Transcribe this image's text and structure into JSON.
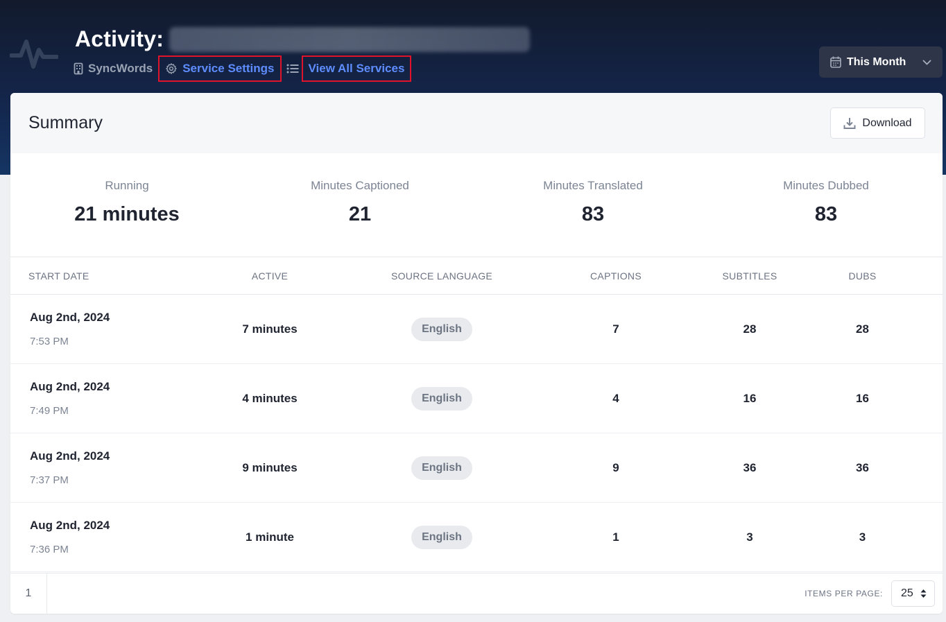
{
  "header": {
    "title": "Activity:",
    "org_name": "SyncWords",
    "service_settings_label": "Service Settings",
    "view_all_label": "View All Services",
    "date_range": "This Month"
  },
  "summary": {
    "title": "Summary",
    "download_label": "Download",
    "stats": [
      {
        "label": "Running",
        "value": "21 minutes"
      },
      {
        "label": "Minutes Captioned",
        "value": "21"
      },
      {
        "label": "Minutes Translated",
        "value": "83"
      },
      {
        "label": "Minutes Dubbed",
        "value": "83"
      }
    ]
  },
  "table": {
    "headers": {
      "start_date": "START DATE",
      "active": "ACTIVE",
      "source_language": "SOURCE LANGUAGE",
      "captions": "CAPTIONS",
      "subtitles": "SUBTITLES",
      "dubs": "DUBS"
    },
    "rows": [
      {
        "date": "Aug 2nd, 2024",
        "time": "7:53 PM",
        "active": "7 minutes",
        "language": "English",
        "captions": "7",
        "subtitles": "28",
        "dubs": "28"
      },
      {
        "date": "Aug 2nd, 2024",
        "time": "7:49 PM",
        "active": "4 minutes",
        "language": "English",
        "captions": "4",
        "subtitles": "16",
        "dubs": "16"
      },
      {
        "date": "Aug 2nd, 2024",
        "time": "7:37 PM",
        "active": "9 minutes",
        "language": "English",
        "captions": "9",
        "subtitles": "36",
        "dubs": "36"
      },
      {
        "date": "Aug 2nd, 2024",
        "time": "7:36 PM",
        "active": "1 minute",
        "language": "English",
        "captions": "1",
        "subtitles": "3",
        "dubs": "3"
      }
    ]
  },
  "pagination": {
    "current_page": "1",
    "items_per_page_label": "ITEMS PER PAGE:",
    "items_per_page": "25"
  },
  "icons": {
    "logo": "activity-pulse-icon",
    "org": "building-icon",
    "settings": "gear-icon",
    "list": "list-icon",
    "calendar": "calendar-icon",
    "chevron": "chevron-down-icon",
    "download": "download-icon",
    "sort": "sort-arrows-icon"
  },
  "colors": {
    "link": "#5e8dff",
    "highlight_border": "#e0132a",
    "hero_top": "#121a2c",
    "hero_bottom": "#153563"
  }
}
